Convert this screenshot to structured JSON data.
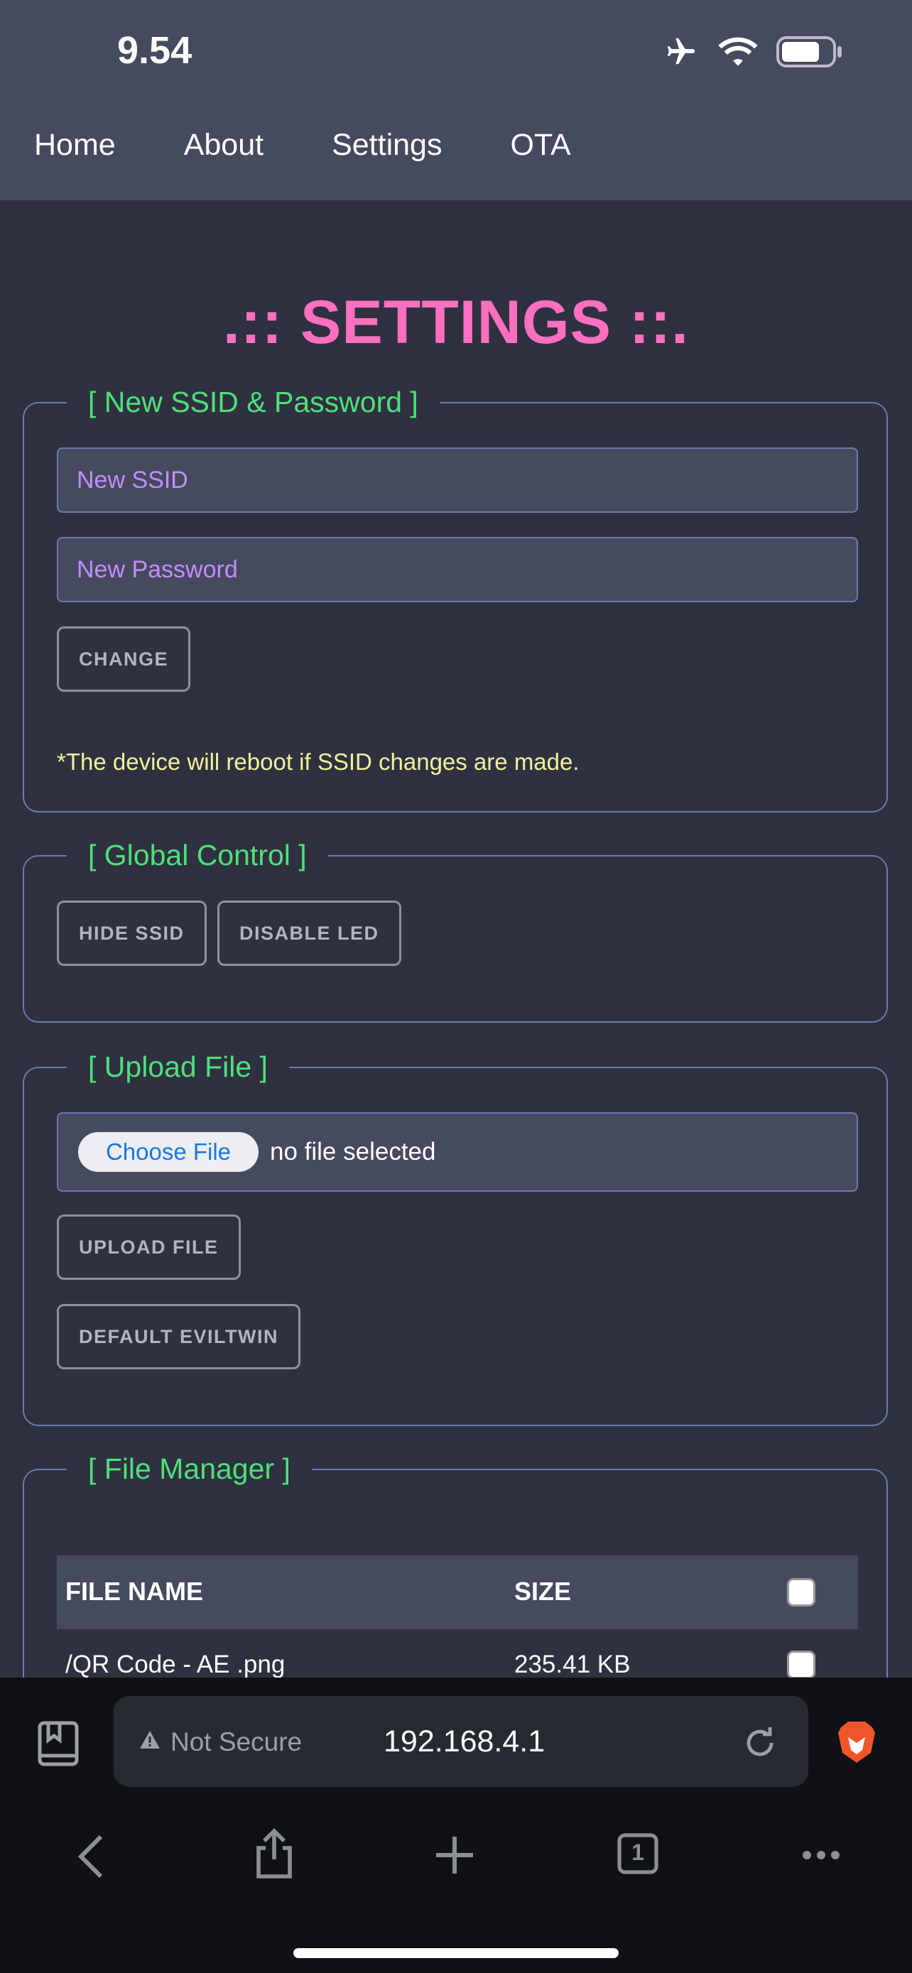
{
  "status_bar": {
    "time": "9.54",
    "icons": [
      "airplane-icon",
      "wifi-icon",
      "battery-icon"
    ]
  },
  "nav": {
    "items": [
      "Home",
      "About",
      "Settings",
      "OTA"
    ]
  },
  "page_title": ".:: SETTINGS ::.",
  "ssid_panel": {
    "legend": "[ New SSID & Password ]",
    "ssid_placeholder": "New SSID",
    "password_placeholder": "New Password",
    "change_button": "CHANGE",
    "note": "*The device will reboot if SSID changes are made."
  },
  "global_panel": {
    "legend": "[ Global Control ]",
    "hide_ssid_button": "HIDE SSID",
    "disable_led_button": "DISABLE LED"
  },
  "upload_panel": {
    "legend": "[ Upload File ]",
    "choose_file_label": "Choose File",
    "no_file_text": "no file selected",
    "upload_button": "UPLOAD FILE",
    "default_button": "DEFAULT EVILTWIN"
  },
  "file_manager": {
    "legend": "[ File Manager ]",
    "columns": [
      "FILE NAME",
      "SIZE"
    ],
    "rows": [
      {
        "name": "/QR Code - AE .png",
        "size": "235.41 KB"
      }
    ]
  },
  "browser": {
    "security_label": "Not Secure",
    "url": "192.168.4.1",
    "tab_count": "1"
  },
  "colors": {
    "background": "#2f3140",
    "nav_bg": "#464a5e",
    "title": "#ff6fc0",
    "legend": "#4ee07a",
    "placeholder": "#c48cff",
    "note": "#f0f29a"
  }
}
